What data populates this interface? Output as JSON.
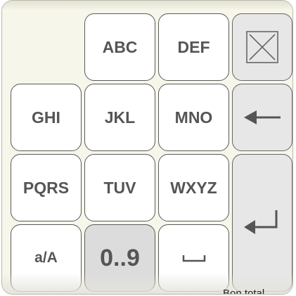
{
  "keypad": {
    "keys": {
      "abc": "ABC",
      "def": "DEF",
      "ghi": "GHI",
      "jkl": "JKL",
      "mno": "MNO",
      "pqrs": "PQRS",
      "tuv": "TUV",
      "wxyz": "WXYZ",
      "case": "a/A",
      "digits": "0..9"
    },
    "icons": {
      "clear": "close-x-icon",
      "backspace": "arrow-left-icon",
      "space": "space-bar-icon",
      "enter": "return-arrow-icon"
    }
  },
  "background_status": "Bon total"
}
